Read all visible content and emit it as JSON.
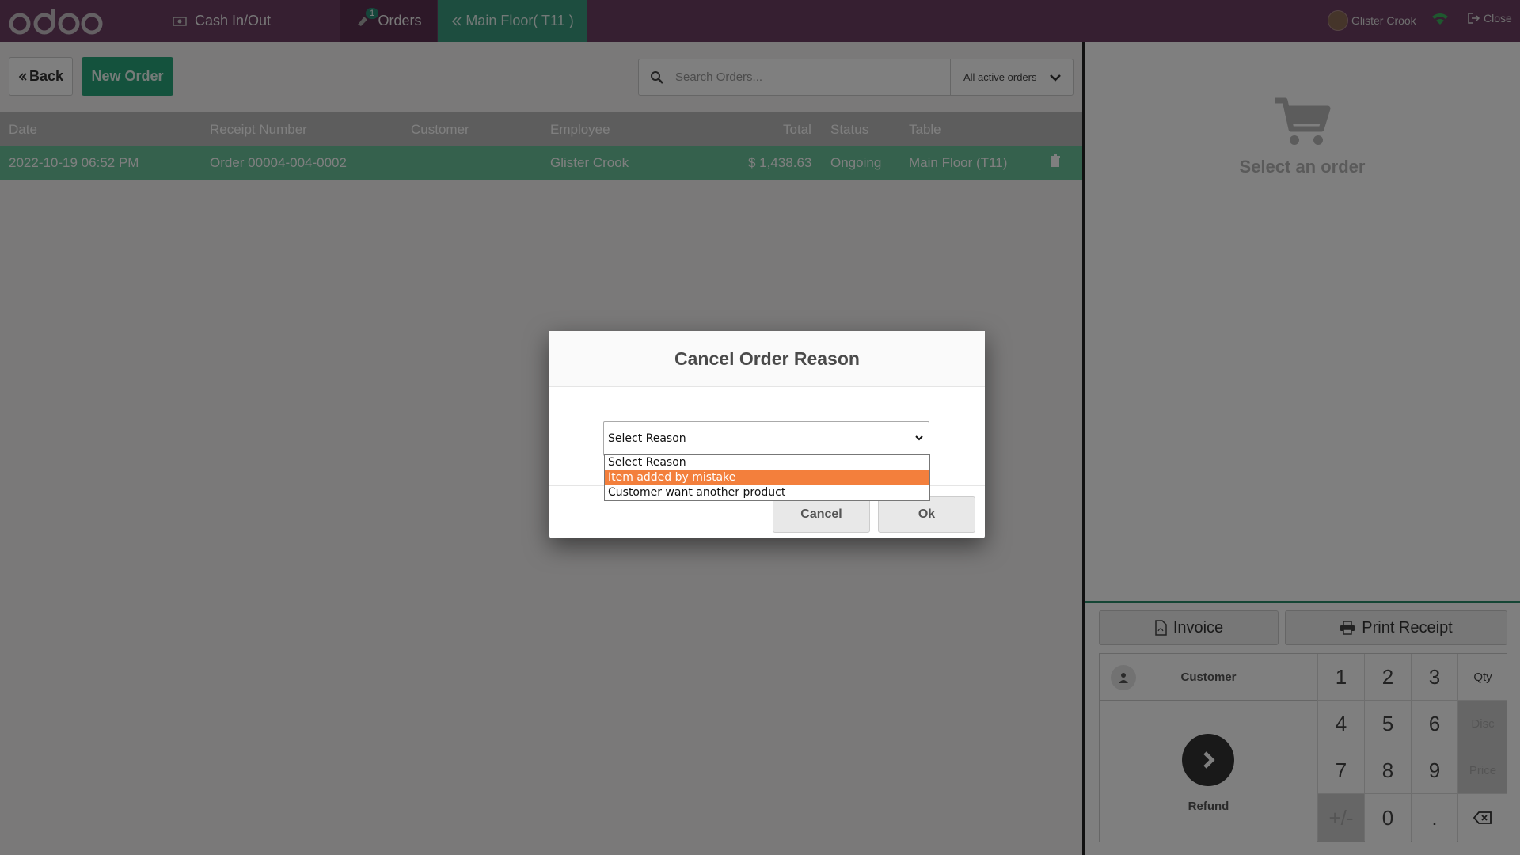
{
  "navbar": {
    "brand": "odoo",
    "cash_label": "Cash In/Out",
    "orders_label": "Orders",
    "orders_badge": "1",
    "floor_label": "Main Floor( T11 )",
    "user_name": "Glister Crook",
    "close_label": "Close"
  },
  "toolbar": {
    "back_label": "Back",
    "new_order_label": "New Order",
    "search_placeholder": "Search Orders...",
    "filter_label": "All active orders"
  },
  "table": {
    "headers": [
      "Date",
      "Receipt Number",
      "Customer",
      "Employee",
      "Total",
      "Status",
      "Table"
    ],
    "rows": [
      {
        "date": "2022-10-19 06:52 PM",
        "receipt": "Order 00004-004-0002",
        "customer": "",
        "employee": "Glister Crook",
        "total": "$ 1,438.63",
        "status": "Ongoing",
        "table": "Main Floor (T11)"
      }
    ]
  },
  "right_panel": {
    "empty_text": "Select an order",
    "invoice_label": "Invoice",
    "print_label": "Print Receipt",
    "customer_label": "Customer",
    "refund_label": "Refund",
    "keys": [
      "1",
      "2",
      "3",
      "Qty",
      "4",
      "5",
      "6",
      "Disc",
      "7",
      "8",
      "9",
      "Price",
      "+/-",
      "0",
      ".",
      ""
    ]
  },
  "modal": {
    "title": "Cancel Order Reason",
    "selected": "Select Reason",
    "options": [
      "Select Reason",
      "Item added by mistake",
      "Customer want another product"
    ],
    "highlighted_option": "Item added by mistake",
    "cancel_label": "Cancel",
    "ok_label": "Ok"
  },
  "colors": {
    "navbar": "#6d3e63",
    "accent": "#28a47a",
    "highlight": "#f37f3c"
  }
}
